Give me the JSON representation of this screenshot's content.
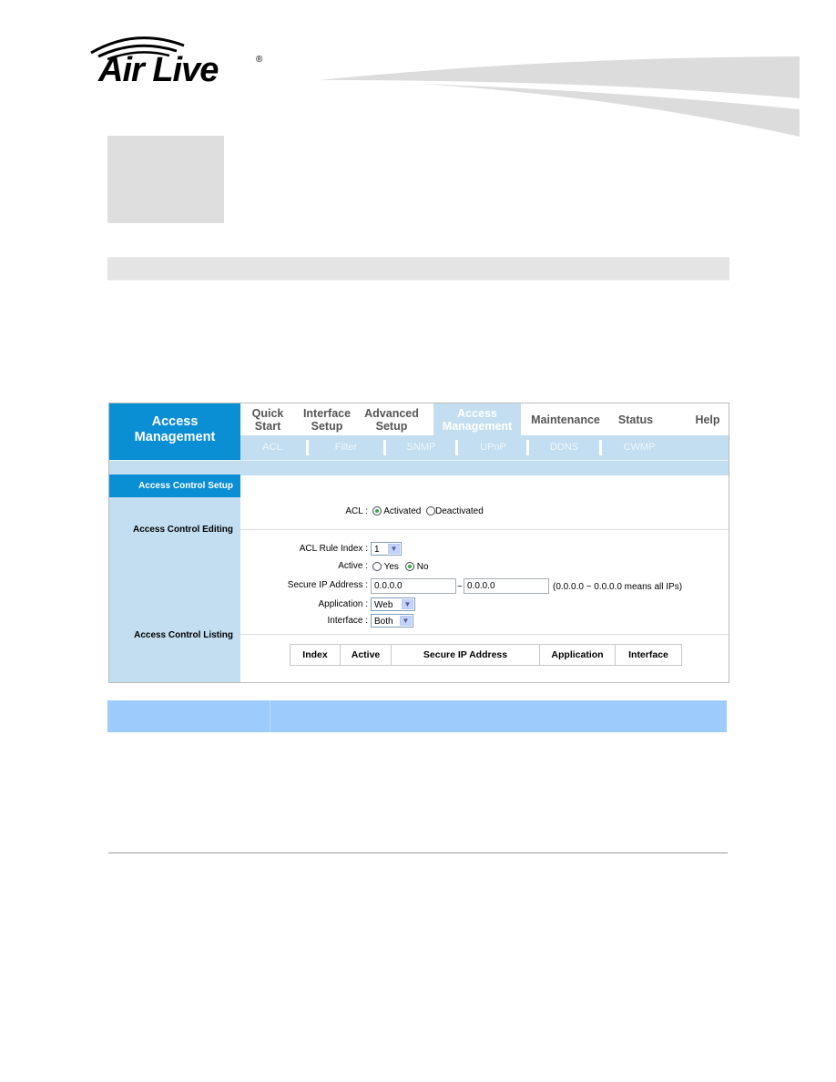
{
  "header": {
    "logo_text": "Air Live",
    "logo_registered": "®"
  },
  "router_ui": {
    "brand_title": "Access Management",
    "brand_line1": "Access",
    "brand_line2": "Management",
    "top_nav": [
      {
        "line1": "Quick",
        "line2": "Start",
        "active": false
      },
      {
        "line1": "Interface",
        "line2": "Setup",
        "active": false
      },
      {
        "line1": "Advanced",
        "line2": "Setup",
        "active": false
      },
      {
        "line1": "Access",
        "line2": "Management",
        "active": true
      },
      {
        "line1": "Maintenance",
        "line2": "",
        "active": false
      },
      {
        "line1": "Status",
        "line2": "",
        "active": false
      },
      {
        "line1": "Help",
        "line2": "",
        "active": false
      }
    ],
    "sub_nav": [
      "ACL",
      "Filter",
      "SNMP",
      "UPnP",
      "DDNS",
      "CWMP"
    ],
    "sidebar": {
      "setup": "Access Control Setup",
      "editing": "Access Control Editing",
      "listing": "Access Control Listing"
    },
    "form": {
      "acl_label": "ACL :",
      "acl_options": [
        "Activated",
        "Deactivated"
      ],
      "acl_selected": "Activated",
      "rule_index_label": "ACL Rule Index :",
      "rule_index_value": "1",
      "active_label": "Active :",
      "active_options": [
        "Yes",
        "No"
      ],
      "active_selected": "No",
      "secure_ip_label": "Secure IP Address :",
      "secure_ip_start": "0.0.0.0",
      "secure_ip_separator": "~",
      "secure_ip_end": "0.0.0.0",
      "secure_ip_hint": "(0.0.0.0 ~ 0.0.0.0 means all IPs)",
      "application_label": "Application :",
      "application_value": "Web",
      "interface_label": "Interface :",
      "interface_value": "Both"
    },
    "listing_table": {
      "columns": [
        "Index",
        "Active",
        "Secure IP Address",
        "Application",
        "Interface"
      ]
    }
  },
  "colors": {
    "brand_blue": "#0a8ed4",
    "nav_light_blue": "#c2def0",
    "band_blue": "#9ccbfc",
    "radio_selected": "#2fb04a"
  }
}
